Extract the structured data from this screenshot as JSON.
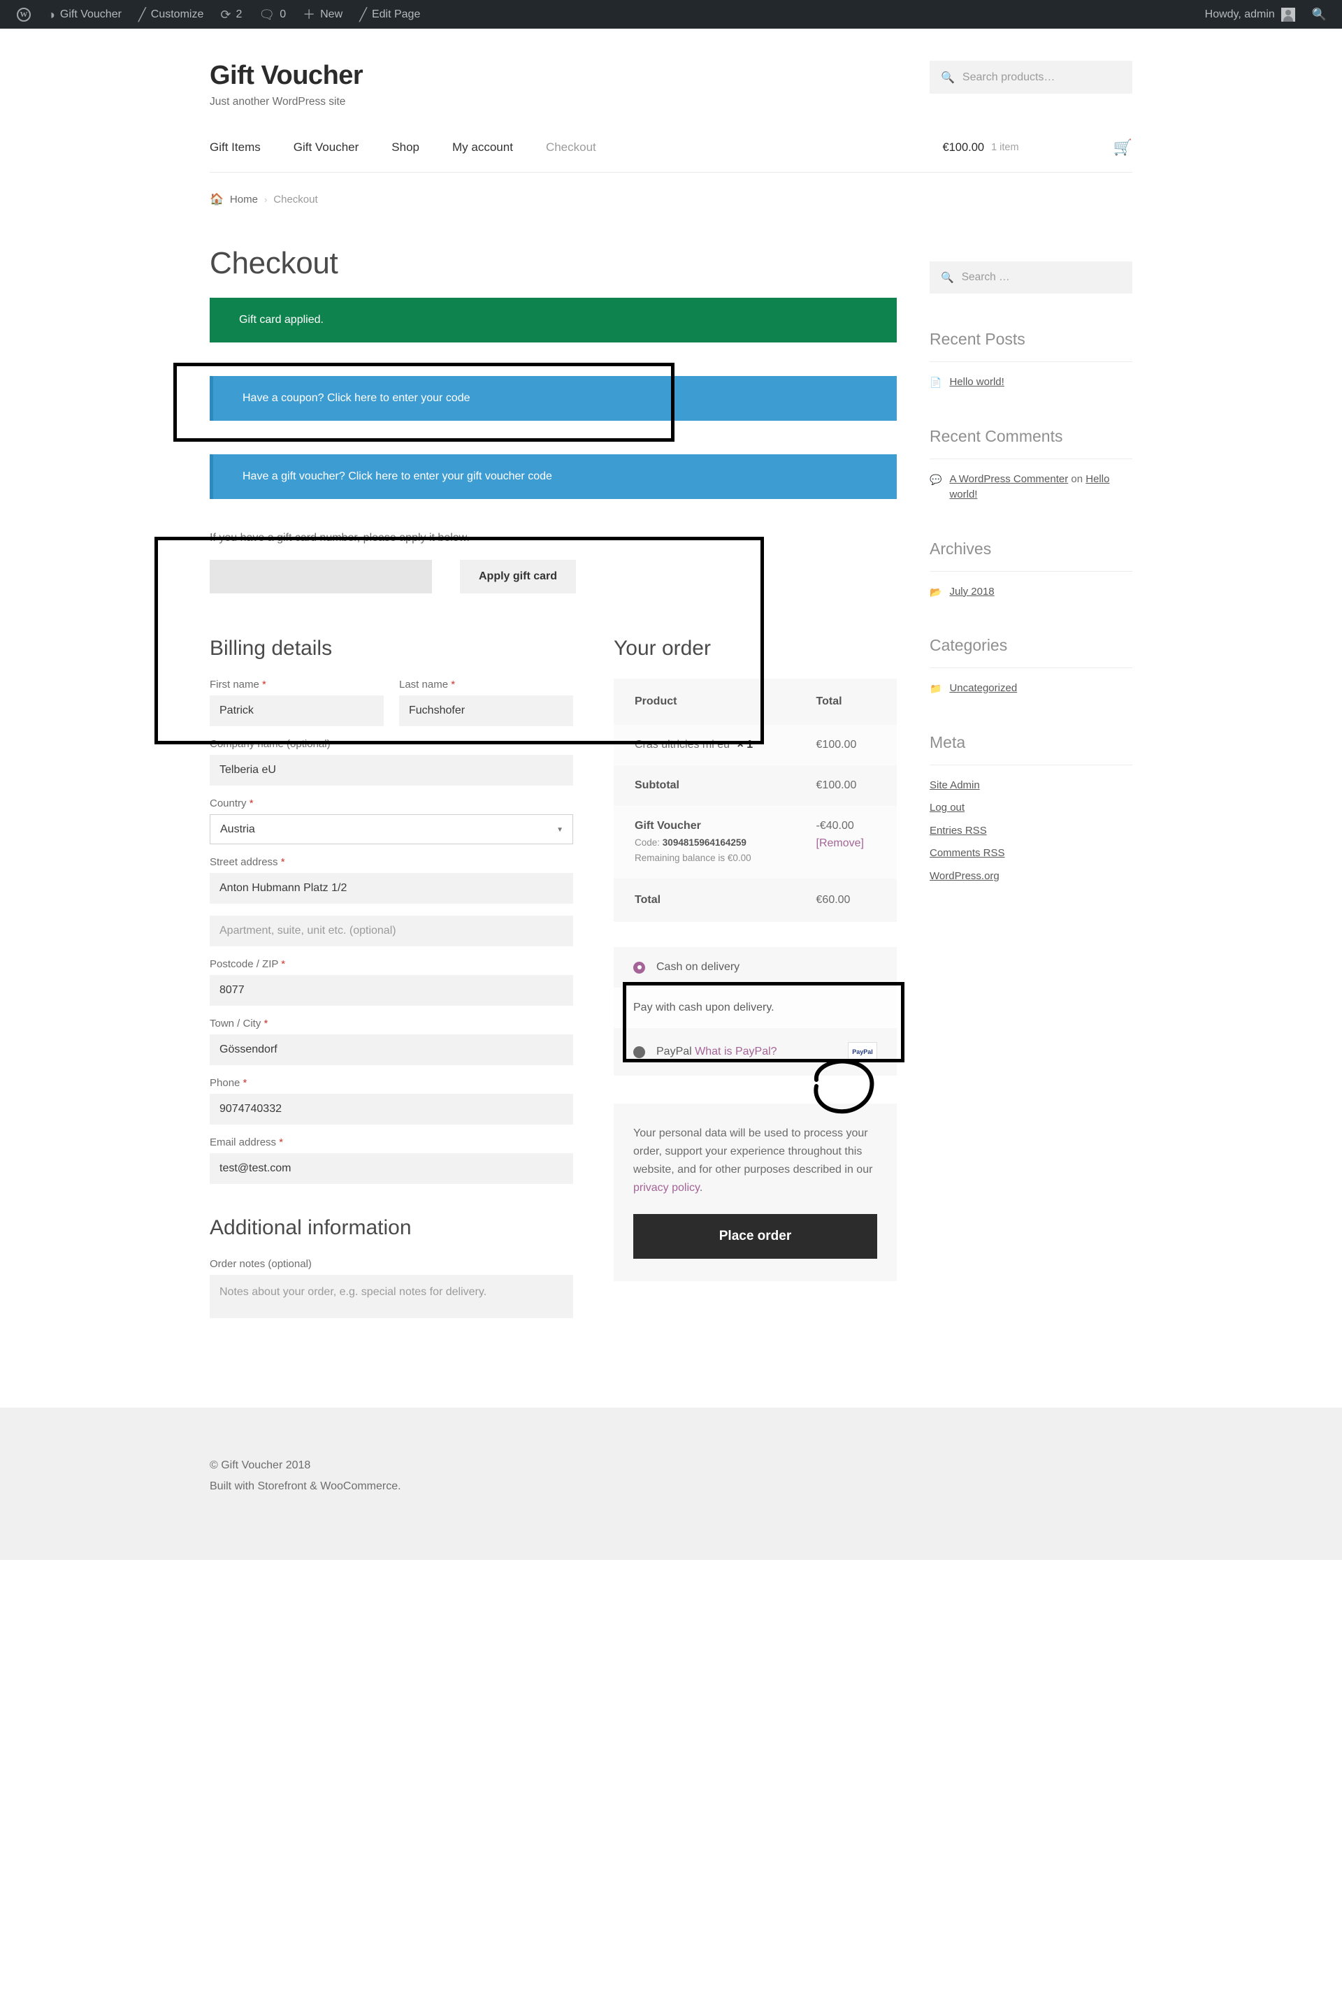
{
  "adminbar": {
    "logo_icon": "wordpress-logo-icon",
    "items": [
      {
        "icon": "dashboard-icon",
        "glyph": "◔",
        "label": "Gift Voucher"
      },
      {
        "icon": "paintbrush-icon",
        "glyph": "╱",
        "label": "Customize"
      },
      {
        "icon": "updates-icon",
        "glyph": "⟳",
        "label": "2"
      },
      {
        "icon": "comment-bubble-icon",
        "glyph": "⬛",
        "label": "0"
      },
      {
        "icon": "plus-icon",
        "glyph": "＋",
        "label": "New"
      },
      {
        "icon": "pencil-icon",
        "glyph": "╱",
        "label": "Edit Page"
      }
    ],
    "howdy": "Howdy, admin",
    "search_icon": "search-icon"
  },
  "header": {
    "site_title": "Gift Voucher",
    "site_description": "Just another WordPress site",
    "product_search_placeholder": "Search products…",
    "nav": [
      {
        "label": "Gift Items",
        "current": false
      },
      {
        "label": "Gift Voucher",
        "current": false
      },
      {
        "label": "Shop",
        "current": false
      },
      {
        "label": "My account",
        "current": false
      },
      {
        "label": "Checkout",
        "current": true
      }
    ],
    "cart_amount": "€100.00",
    "cart_count": "1 item",
    "cart_icon": "shopping-basket-icon"
  },
  "breadcrumb": {
    "home_icon": "home-icon",
    "home": "Home",
    "separator": "›",
    "current": "Checkout"
  },
  "main": {
    "page_title": "Checkout",
    "notice_success": "Gift card applied.",
    "coupon_toggle": "Have a coupon? Click here to enter your code",
    "voucher_toggle": "Have a gift voucher? Click here to enter your gift voucher code",
    "gift_hint": "If you have a gift card number, please apply it below.",
    "gift_input_value": "",
    "gift_input_placeholder": "",
    "apply_gift_card_label": "Apply gift card"
  },
  "billing": {
    "title": "Billing details",
    "first_name_label": "First name",
    "first_name_value": "Patrick",
    "last_name_label": "Last name",
    "last_name_value": "Fuchshofer",
    "company_label": "Company name (optional)",
    "company_value": "Telberia eU",
    "country_label": "Country",
    "country_value": "Austria",
    "street_label": "Street address",
    "street_value": "Anton Hubmann Platz 1/2",
    "apartment_placeholder": "Apartment, suite, unit etc. (optional)",
    "apartment_value": "",
    "postcode_label": "Postcode / ZIP",
    "postcode_value": "8077",
    "city_label": "Town / City",
    "city_value": "Gössendorf",
    "phone_label": "Phone",
    "phone_value": "9074740332",
    "email_label": "Email address",
    "email_value": "test@test.com",
    "required_mark": "*"
  },
  "additional": {
    "title": "Additional information",
    "notes_label": "Order notes (optional)",
    "notes_placeholder": "Notes about your order, e.g. special notes for delivery.",
    "notes_value": ""
  },
  "order": {
    "title": "Your order",
    "col_product": "Product",
    "col_total": "Total",
    "product_name": "Cras ultricies mi eu",
    "product_qty": "× 1",
    "product_total": "€100.00",
    "subtotal_label": "Subtotal",
    "subtotal_value": "€100.00",
    "gift_voucher_label": "Gift Voucher",
    "gift_voucher_code_prefix": "Code:",
    "gift_voucher_code": "3094815964164259",
    "gift_voucher_balance": "Remaining balance is €0.00",
    "gift_voucher_amount": "-€40.00",
    "gift_voucher_remove": "[Remove]",
    "total_label": "Total",
    "total_value": "€60.00"
  },
  "payment": {
    "cod_label": "Cash on delivery",
    "cod_desc": "Pay with cash upon delivery.",
    "paypal_label": "PayPal",
    "paypal_help": "What is PayPal?",
    "paypal_badge": "PayPal",
    "privacy_text_1": "Your personal data will be used to process your order, support your experience throughout this website, and for other purposes described in our ",
    "privacy_link": "privacy policy",
    "privacy_text_2": ".",
    "place_order": "Place order"
  },
  "sidebar": {
    "search_placeholder": "Search …",
    "search_icon": "search-icon",
    "recent_posts_title": "Recent Posts",
    "recent_posts": [
      {
        "icon": "document-icon",
        "label": "Hello world!"
      }
    ],
    "recent_comments_title": "Recent Comments",
    "recent_comments": [
      {
        "icon": "comment-icon",
        "author": "A WordPress Commenter",
        "on": " on ",
        "post": "Hello world!"
      }
    ],
    "archives_title": "Archives",
    "archives": [
      {
        "icon": "folder-open-icon",
        "label": "July 2018"
      }
    ],
    "categories_title": "Categories",
    "categories": [
      {
        "icon": "folder-icon",
        "label": "Uncategorized"
      }
    ],
    "meta_title": "Meta",
    "meta": [
      {
        "label": "Site Admin"
      },
      {
        "label": "Log out"
      },
      {
        "label": "Entries RSS"
      },
      {
        "label": "Comments RSS"
      },
      {
        "label": "WordPress.org"
      }
    ]
  },
  "footer": {
    "copyright": "© Gift Voucher 2018",
    "built_with": "Built with Storefront & WooCommerce."
  },
  "annotations": {
    "box_success_notice": "highlight around gift card applied notice",
    "box_voucher_form": "highlight around gift voucher form",
    "box_voucher_row": "highlight around gift voucher order row",
    "circle_total": "hand-drawn circle around order total"
  },
  "colors": {
    "admin_bar": "#23282d",
    "success": "#0f834d",
    "info": "#3d9cd2",
    "accent": "#a46497",
    "button_dark": "#2c2c2c",
    "annotation": "#000000"
  }
}
